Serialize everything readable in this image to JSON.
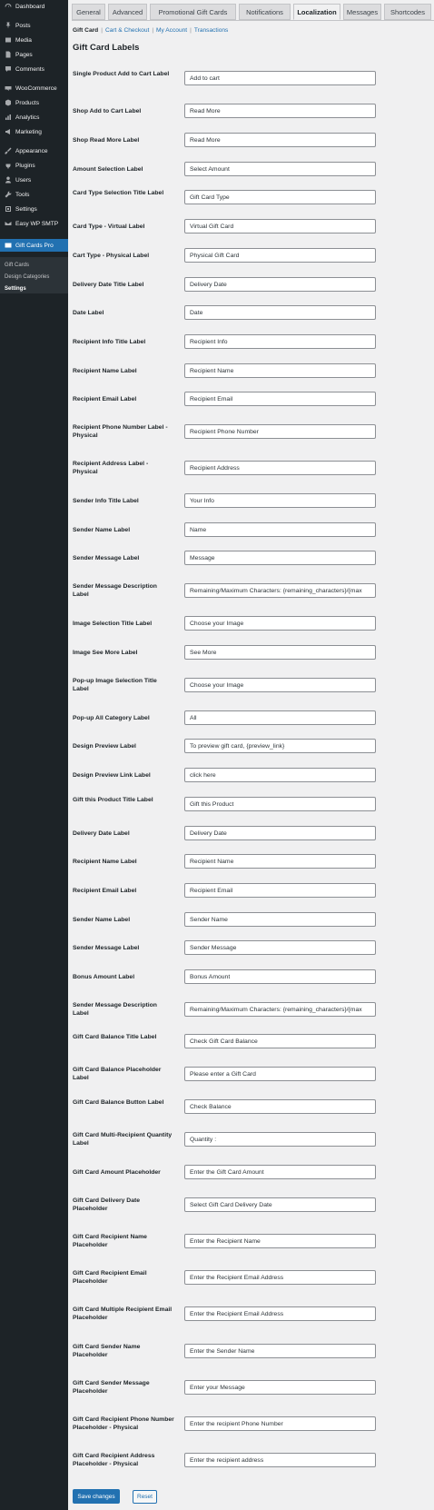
{
  "sidebar": {
    "items": [
      {
        "label": "Dashboard",
        "icon": "dashboard-icon"
      },
      {
        "label": "Posts",
        "icon": "pin-icon"
      },
      {
        "label": "Media",
        "icon": "media-icon"
      },
      {
        "label": "Pages",
        "icon": "page-icon"
      },
      {
        "label": "Comments",
        "icon": "comment-icon"
      },
      {
        "label": "WooCommerce",
        "icon": "woocommerce-icon"
      },
      {
        "label": "Products",
        "icon": "products-icon"
      },
      {
        "label": "Analytics",
        "icon": "analytics-icon"
      },
      {
        "label": "Marketing",
        "icon": "megaphone-icon"
      },
      {
        "label": "Appearance",
        "icon": "brush-icon"
      },
      {
        "label": "Plugins",
        "icon": "plug-icon"
      },
      {
        "label": "Users",
        "icon": "user-icon"
      },
      {
        "label": "Tools",
        "icon": "wrench-icon"
      },
      {
        "label": "Settings",
        "icon": "settings-icon"
      },
      {
        "label": "Easy WP SMTP",
        "icon": "smtp-icon"
      },
      {
        "label": "Gift Cards Pro",
        "icon": "gift-card-icon"
      }
    ],
    "submenu": [
      {
        "label": "Gift Cards"
      },
      {
        "label": "Design Categories"
      },
      {
        "label": "Settings"
      }
    ]
  },
  "tabs": [
    {
      "label": "General"
    },
    {
      "label": "Advanced"
    },
    {
      "label": "Promotional Gift Cards"
    },
    {
      "label": "Notifications"
    },
    {
      "label": "Localization"
    },
    {
      "label": "Messages"
    },
    {
      "label": "Shortcodes"
    }
  ],
  "subtabs": [
    {
      "label": "Gift Card"
    },
    {
      "label": "Cart & Checkout"
    },
    {
      "label": "My Account"
    },
    {
      "label": "Transactions"
    }
  ],
  "section_title": "Gift Card Labels",
  "fields": [
    {
      "label": "Single Product Add to Cart Label",
      "value": "Add to cart"
    },
    {
      "label": "Shop Add to Cart Label",
      "value": "Read More"
    },
    {
      "label": "Shop Read More Label",
      "value": "Read More"
    },
    {
      "label": "Amount Selection Label",
      "value": "Select Amount"
    },
    {
      "label": "Card Type Selection Title Label",
      "value": "Gift Card Type"
    },
    {
      "label": "Card Type - Virtual Label",
      "value": "Virtual Gift Card"
    },
    {
      "label": "Cart Type - Physical Label",
      "value": "Physical Gift Card"
    },
    {
      "label": "Delivery Date Title Label",
      "value": "Delivery Date"
    },
    {
      "label": "Date Label",
      "value": "Date"
    },
    {
      "label": "Recipient Info Title Label",
      "value": "Recipient Info"
    },
    {
      "label": "Recipient Name Label",
      "value": "Recipient Name"
    },
    {
      "label": "Recipient Email Label",
      "value": "Recipient Email"
    },
    {
      "label": "Recipient Phone Number Label - Physical",
      "value": "Recipient Phone Number"
    },
    {
      "label": "Recipient Address Label - Physical",
      "value": "Recipient Address"
    },
    {
      "label": "Sender Info Title Label",
      "value": "Your Info"
    },
    {
      "label": "Sender Name Label",
      "value": "Name"
    },
    {
      "label": "Sender Message Label",
      "value": "Message"
    },
    {
      "label": "Sender Message Description Label",
      "value": "Remaining/Maximum Characters: {remaining_characters}/{max"
    },
    {
      "label": "Image Selection Title Label",
      "value": "Choose your Image"
    },
    {
      "label": "Image See More Label",
      "value": "See More"
    },
    {
      "label": "Pop-up Image Selection Title Label",
      "value": "Choose your Image"
    },
    {
      "label": "Pop-up All Category Label",
      "value": "All"
    },
    {
      "label": "Design Preview Label",
      "value": "To preview gift card, {preview_link}"
    },
    {
      "label": "Design Preview Link Label",
      "value": "click here"
    },
    {
      "label": "Gift this Product Title Label",
      "value": "Gift this Product"
    },
    {
      "label": "Delivery Date Label",
      "value": "Delivery Date"
    },
    {
      "label": "Recipient Name Label",
      "value": "Recipient Name"
    },
    {
      "label": "Recipient Email Label",
      "value": "Recipient Email"
    },
    {
      "label": "Sender Name Label",
      "value": "Sender Name"
    },
    {
      "label": "Sender Message Label",
      "value": "Sender Message"
    },
    {
      "label": "Bonus Amount Label",
      "value": "Bonus Amount"
    },
    {
      "label": "Sender Message Description Label",
      "value": "Remaining/Maximum Characters: {remaining_characters}/{max"
    },
    {
      "label": "Gift Card Balance Title Label",
      "value": "Check Gift Card Balance"
    },
    {
      "label": "Gift Card Balance Placeholder Label",
      "value": "Please enter a Gift Card"
    },
    {
      "label": "Gift Card Balance Button Label",
      "value": "Check Balance"
    },
    {
      "label": "Gift Card Multi-Recipient Quantity Label",
      "value": "Quantity :"
    },
    {
      "label": "Gift Card Amount Placeholder",
      "value": "Enter the Gift Card Amount"
    },
    {
      "label": "Gift Card Delivery Date Placeholder",
      "value": "Select Gift Card Delivery Date"
    },
    {
      "label": "Gift Card Recipient Name Placeholder",
      "value": "Enter the Recipient Name"
    },
    {
      "label": "Gift Card Recipient Email Placeholder",
      "value": "Enter the Recipient Email Address"
    },
    {
      "label": "Gift Card Multiple Recipient Email Placeholder",
      "value": "Enter the Recipient Email Address"
    },
    {
      "label": "Gift Card Sender Name Placeholder",
      "value": "Enter the Sender Name"
    },
    {
      "label": "Gift Card Sender Message Placeholder",
      "value": "Enter your Message"
    },
    {
      "label": "Gift Card Recipient Phone Number Placeholder - Physical",
      "value": "Enter the recipient Phone Number"
    },
    {
      "label": "Gift Card Recipient Address Placeholder - Physical",
      "value": "Enter the recipient address"
    }
  ],
  "buttons": {
    "save": "Save changes",
    "reset": "Reset"
  },
  "colors": {
    "accent": "#2271b1",
    "sidebar": "#1d2327",
    "background": "#f0f0f1"
  }
}
